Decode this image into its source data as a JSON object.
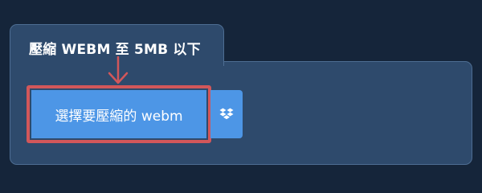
{
  "tab": {
    "title": "壓縮 WEBM 至 5MB 以下"
  },
  "upload": {
    "button_label": "選擇要壓縮的 webm"
  },
  "icons": {
    "pointer": "arrow-down-icon",
    "cloud": "dropbox-icon"
  },
  "colors": {
    "background": "#15253a",
    "panel": "#2e4a6c",
    "button": "#4d96e6",
    "highlight": "#d2575a"
  }
}
